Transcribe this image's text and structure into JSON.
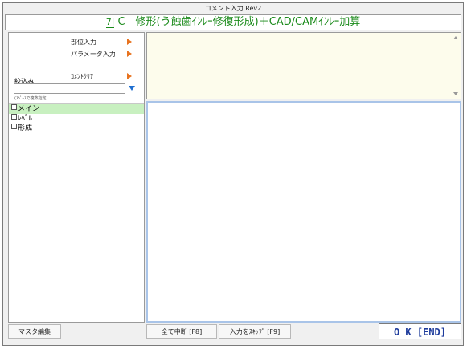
{
  "window": {
    "title": "コメント入力 Rev2"
  },
  "header": {
    "tooth_label": "7|",
    "text": "C　修形(う蝕歯ｲﾝﾚｰ修復形成)＋CAD/CAMｲﾝﾚｰ加算"
  },
  "left_panel": {
    "buttons": [
      {
        "label": "部位入力"
      },
      {
        "label": "パラメータ入力"
      },
      {
        "label": "ｺﾒﾝﾄｸﾘｱ"
      }
    ],
    "filter_label": "絞込み",
    "filter_value": "",
    "filter_hint": "(ｽﾍﾟｰｽで複数指定)",
    "tree": [
      {
        "label": "メイン",
        "selected": true
      },
      {
        "label": "ﾚﾍﾞﾙ",
        "selected": false
      },
      {
        "label": "形成",
        "selected": false
      }
    ]
  },
  "footer": {
    "master_edit": "マスタ編集",
    "cancel_all": "全て中断 [F8]",
    "skip_input": "入力をｽｷｯﾌﾟ [F9]",
    "ok": "O K [END]"
  },
  "colors": {
    "header_text": "#1a8a1a",
    "arrow": "#e8731f",
    "selected_row": "#c8f0c0",
    "ok_text": "#1e3c9c",
    "top_pane": "#fdfcec"
  },
  "icons": {
    "arrow": "triangle-right-icon",
    "dropdown": "triangle-down-icon",
    "checkbox": "checkbox-icon"
  }
}
